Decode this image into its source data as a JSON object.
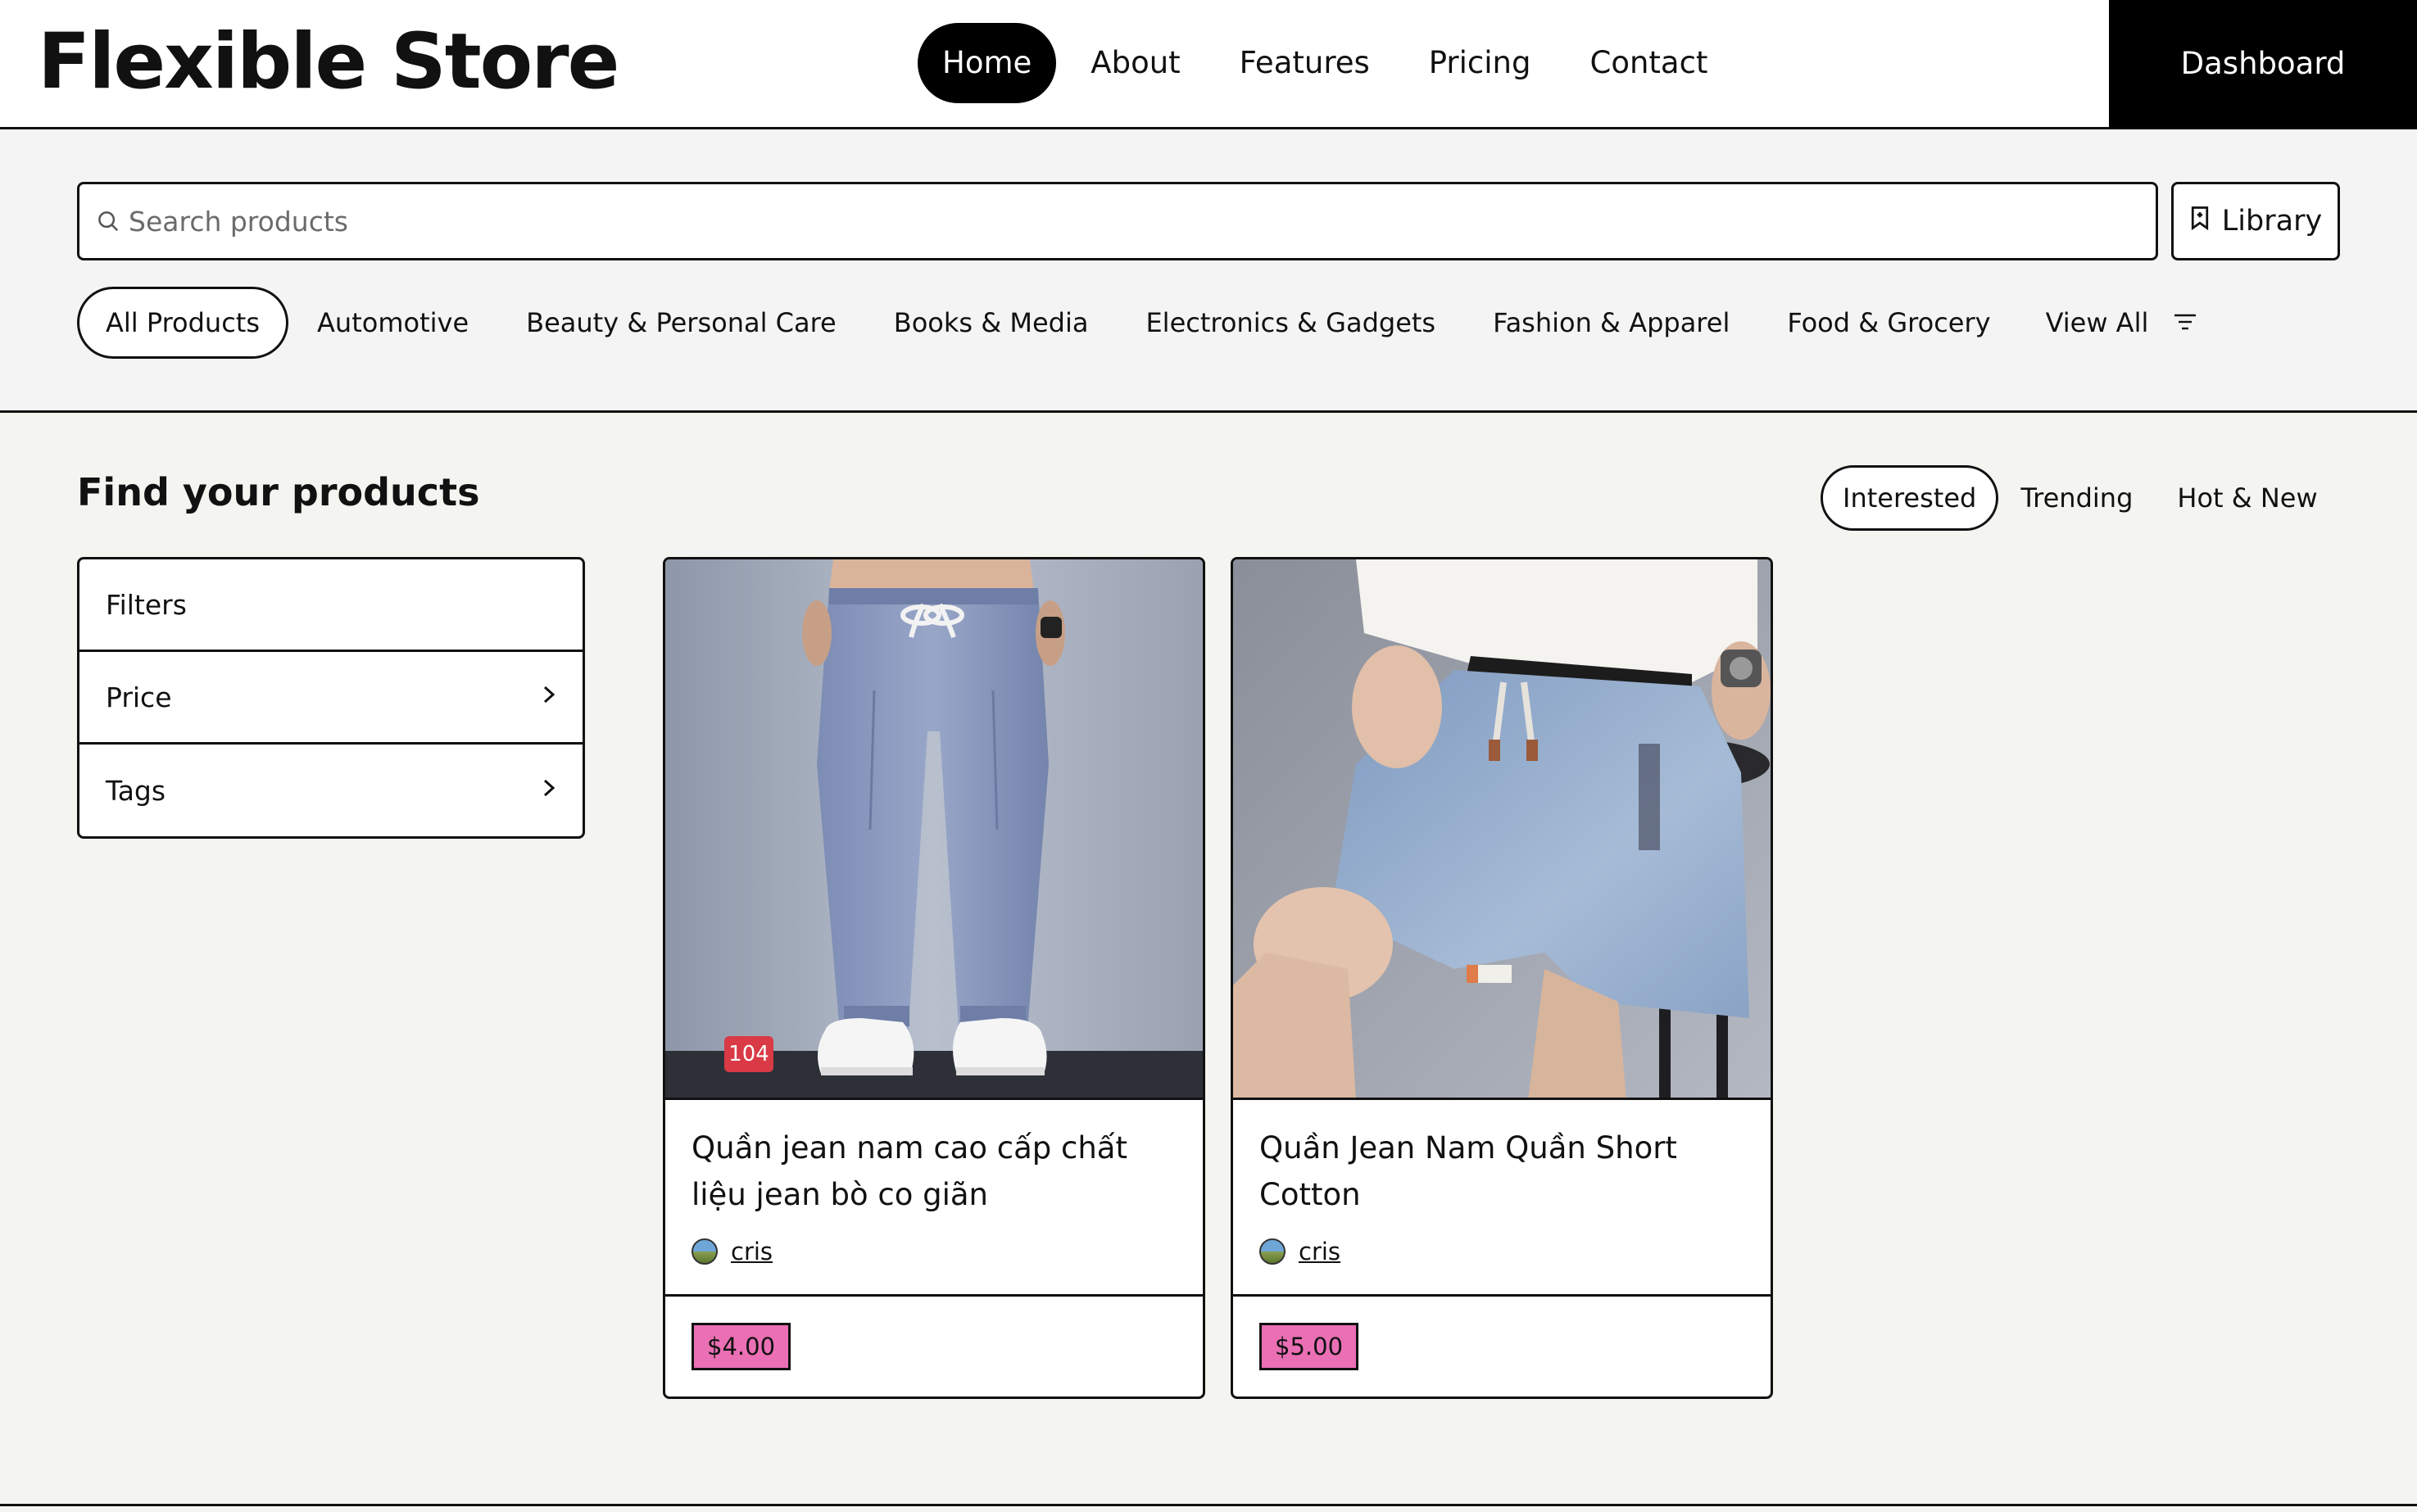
{
  "brand": "Flexible Store",
  "nav": {
    "items": [
      "Home",
      "About",
      "Features",
      "Pricing",
      "Contact"
    ],
    "active": "Home",
    "dashboard": "Dashboard"
  },
  "search": {
    "placeholder": "Search products",
    "value": "",
    "library_label": "Library"
  },
  "categories": {
    "items": [
      "All Products",
      "Automotive",
      "Beauty & Personal Care",
      "Books & Media",
      "Electronics & Gadgets",
      "Fashion & Apparel",
      "Food & Grocery"
    ],
    "active": "All Products",
    "view_all": "View All"
  },
  "main": {
    "title": "Find your products",
    "sort_tabs": [
      "Interested",
      "Trending",
      "Hot & New"
    ],
    "active_sort": "Interested"
  },
  "filters": {
    "header": "Filters",
    "rows": [
      "Price",
      "Tags"
    ]
  },
  "products": [
    {
      "title": "Quần jean nam cao cấp chất liệu jean bò co giãn",
      "author": "cris",
      "price": "$4.00",
      "badge": "104"
    },
    {
      "title": "Quần Jean Nam Quần Short Cotton",
      "author": "cris",
      "price": "$5.00",
      "badge": ""
    }
  ],
  "colors": {
    "accent": "#000000",
    "price_tag": "#ea6fb4",
    "badge": "#d93a45",
    "page_bg": "#f4f4f0"
  },
  "icons": {
    "search": "search-icon",
    "library": "bookmark-icon",
    "filter": "filter-lines-icon",
    "chevron": "chevron-right-icon"
  }
}
